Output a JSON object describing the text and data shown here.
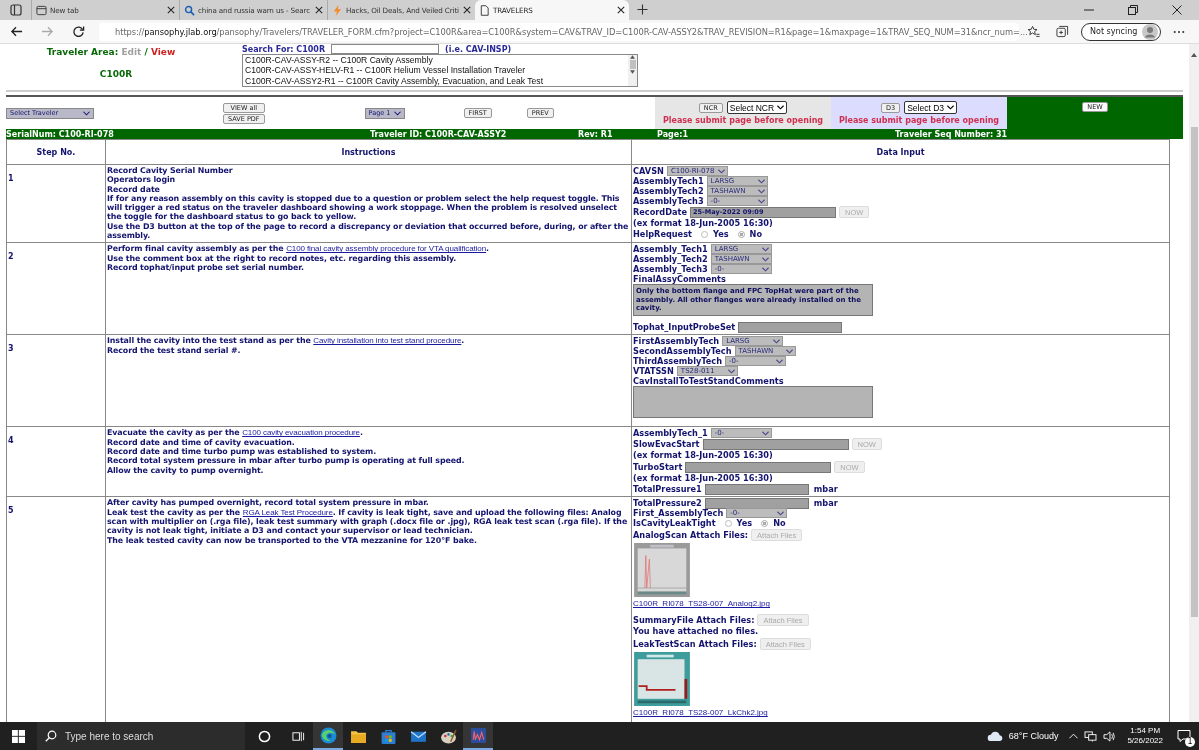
{
  "browser": {
    "tabs": [
      {
        "kind": "newtab",
        "title": "New tab",
        "selected": false
      },
      {
        "kind": "search",
        "title": "china and russia warn us - Searc",
        "selected": false
      },
      {
        "kind": "news",
        "title": "Hacks, Oil Deals, And Veiled Criti",
        "selected": false
      },
      {
        "kind": "page",
        "title": "TRAVELERS",
        "selected": true
      }
    ],
    "url": {
      "scheme": "https://",
      "host": "pansophy.jlab.org",
      "path": "/pansophy/Travelers/TRAVELER_FORM.cfm?project=C100R&area=C100R&system=CAV&TRAV_ID=C100R-CAV-ASSY2&TRAV_REVISION=R1&page=1&maxpage=1&TRAV_SEQ_NUM=31&ncr_num=..."
    },
    "profile": "Not syncing"
  },
  "header": {
    "area_label": "Traveler Area:",
    "edit": "Edit",
    "separator": "/",
    "view": "View",
    "area": "C100R",
    "search_label": "Search For: C100R",
    "search_example": "(i.e. CAV-INSP)",
    "travelers": [
      "C100R-CAV-ASSY-R2 -- C100R Cavity Assembly",
      "C100R-CAV-ASSY-HELV-R1 -- C100R Helium Vessel Installation Traveler",
      "C100R-CAV-ASSY2-R1 -- C100R Cavity Assembly, Evacuation, and Leak Test"
    ]
  },
  "toolbar": {
    "traveler_select": "Select Traveler",
    "view_all": "VIEW all",
    "save_pdf": "SAVE PDF",
    "page_select": "Page 1",
    "first": "FIRST",
    "prev": "PREV",
    "ncr": {
      "button": "NCR",
      "select": "Select NCR",
      "message": "Please submit page before opening"
    },
    "d3": {
      "button": "D3",
      "select": "Select D3",
      "message": "Please submit page before opening"
    },
    "new": "NEW"
  },
  "info_bar": [
    "SerialNum: C100-RI-078",
    "Traveler ID: C100R-CAV-ASSY2",
    "Rev: R1",
    "Page:1",
    "Traveler Seq Number: 31"
  ],
  "table": {
    "columns": [
      "Step No.",
      "Instructions",
      "Data Input"
    ],
    "steps": [
      {
        "number": "1",
        "instructions": [
          {
            "text": "Record Cavity Serial Number"
          },
          {
            "text": "Operators login"
          },
          {
            "text": "Record date"
          },
          {
            "text": "If for any reason assembly on this cavity is stopped due to a question or problem select the help request toggle. This will trigger a red status on the traveler dashboard showing a work stoppage. When the problem is resolved unselect the toggle for the dashboard status to go back to yellow."
          },
          {
            "text": "Use the D3 button at the top of the page to record a discrepancy or deviation that occurred before, during, or after the assembly."
          }
        ],
        "inputs": [
          {
            "kind": "select",
            "label": "CAVSN",
            "value": "C100-RI-078"
          },
          {
            "kind": "select",
            "label": "AssemblyTech1",
            "value": "LARSG"
          },
          {
            "kind": "select",
            "label": "AssemblyTech2",
            "value": "TASHAWN"
          },
          {
            "kind": "select",
            "label": "AssemblyTech3",
            "value": "-0-"
          },
          {
            "kind": "datetime",
            "label": "RecordDate",
            "value": "25-May-2022 09:09",
            "button": "NOW"
          },
          {
            "kind": "note",
            "text": "(ex format 18-Jun-2005 16:30)"
          },
          {
            "kind": "radio",
            "label": "HelpRequest",
            "options": [
              {
                "label": "Yes",
                "selected": false
              },
              {
                "label": "No",
                "selected": true
              }
            ]
          }
        ]
      },
      {
        "number": "2",
        "instructions": [
          {
            "text": "Perform final cavity assembly as per the ",
            "link": "C100 final cavity assembly procedure for VTA qualification",
            "after": "."
          },
          {
            "text": "Use the comment box at the right to record notes, etc. regarding this assembly."
          },
          {
            "text": "Record tophat/input probe set serial number."
          }
        ],
        "inputs": [
          {
            "kind": "select",
            "label": "Assembly_Tech1",
            "value": "LARSG"
          },
          {
            "kind": "select",
            "label": "Assembly_Tech2",
            "value": "TASHAWN"
          },
          {
            "kind": "select",
            "label": "Assembly_Tech3",
            "value": "-0-"
          },
          {
            "kind": "textarea",
            "label": "FinalAssyComments",
            "value": "Only the bottom flange and FPC TopHat were part of the assembly.  All other flanges were already installed on the cavity."
          },
          {
            "kind": "text",
            "label": "Tophat_InputProbeSet"
          }
        ]
      },
      {
        "number": "3",
        "instructions": [
          {
            "text": "Install the cavity into the test stand as per the ",
            "link": "Cavity installation into test stand procedure",
            "after": "."
          },
          {
            "text": "Record the test stand serial #."
          }
        ],
        "inputs": [
          {
            "kind": "select",
            "label": "FirstAssemblyTech",
            "value": "LARSG"
          },
          {
            "kind": "select",
            "label": "SecondAssemblyTech",
            "value": "TASHAWN"
          },
          {
            "kind": "select",
            "label": "ThirdAssemblyTech",
            "value": "-0-"
          },
          {
            "kind": "select",
            "label": "VTATSSN",
            "value": "TS28-011"
          },
          {
            "kind": "textarea",
            "label": "CavInstallToTestStandComments"
          }
        ]
      },
      {
        "number": "4",
        "instructions": [
          {
            "text": "Evacuate the cavity as per the ",
            "link": "C100 cavity evacuation procedure",
            "after": "."
          },
          {
            "text": "Record date and time of cavity evacuation."
          },
          {
            "text": "Record date and time turbo pump was established to system."
          },
          {
            "text": "Record total system pressure in mbar after turbo pump is operating at full speed."
          },
          {
            "text": "Allow the cavity to pump overnight."
          }
        ],
        "inputs": [
          {
            "kind": "select",
            "label": "AssemblyTech_1",
            "value": "-0-"
          },
          {
            "kind": "datetime",
            "label": "SlowEvacStart",
            "button": "NOW"
          },
          {
            "kind": "note",
            "text": "(ex format 18-Jun-2005 16:30)"
          },
          {
            "kind": "datetime",
            "label": "TurboStart",
            "button": "NOW"
          },
          {
            "kind": "note",
            "text": "(ex format 18-Jun-2005 16:30)"
          },
          {
            "kind": "text",
            "label": "TotalPressure1",
            "unit": "mbar"
          }
        ]
      },
      {
        "number": "5",
        "instructions": [
          {
            "text": "After cavity has pumped overnight, record total system pressure in mbar."
          },
          {
            "text": "Leak test the cavity as per the ",
            "link": "RGA Leak Test Procedure",
            "after": ". If cavity is leak tight, save and upload the following files: Analog scan with multiplier on (.rga file), leak test summary with graph (.docx file or .jpg), RGA leak test scan (.rga file). If the cavity is not leak tight, initiate a D3 and contact your supervisor or lead technician."
          },
          {
            "text": "The leak tested cavity can now be transported to the VTA mezzanine for 120°F bake."
          }
        ],
        "inputs": [
          {
            "kind": "text",
            "label": "TotalPressure2",
            "unit": "mbar"
          },
          {
            "kind": "select",
            "label": "First_AssemblyTech",
            "value": "-0-"
          },
          {
            "kind": "radio",
            "label": "IsCavityLeakTight",
            "options": [
              {
                "label": "Yes",
                "selected": false
              },
              {
                "label": "No",
                "selected": true
              }
            ]
          },
          {
            "kind": "attach",
            "label": "AnalogScan Attach Files:",
            "button": "Attach Files"
          },
          {
            "link": "C100R_RI078_TS28-007_Analog2.jpg"
          },
          {
            "kind": "attach",
            "label": "SummaryFile Attach Files:",
            "button": "Attach Files"
          },
          {
            "kind": "note",
            "text": "You have attached no files."
          },
          {
            "kind": "attach",
            "label": "LeakTestScan Attach Files:",
            "button": "Attach Files"
          },
          {
            "link": "C100R_RI078_TS28-007_LkChk2.jpg"
          }
        ]
      }
    ]
  },
  "taskbar": {
    "search_placeholder": "Type here to search",
    "apps": [
      {
        "kind": "edge",
        "active": true
      },
      {
        "kind": "explorer",
        "active": false
      },
      {
        "kind": "store",
        "active": false
      },
      {
        "kind": "mail",
        "active": false
      },
      {
        "kind": "paint",
        "active": false
      },
      {
        "kind": "chart",
        "active": true
      }
    ],
    "weather": "68°F Cloudy",
    "time": "1:54 PM",
    "date": "5/26/2022",
    "notifications": "1"
  }
}
